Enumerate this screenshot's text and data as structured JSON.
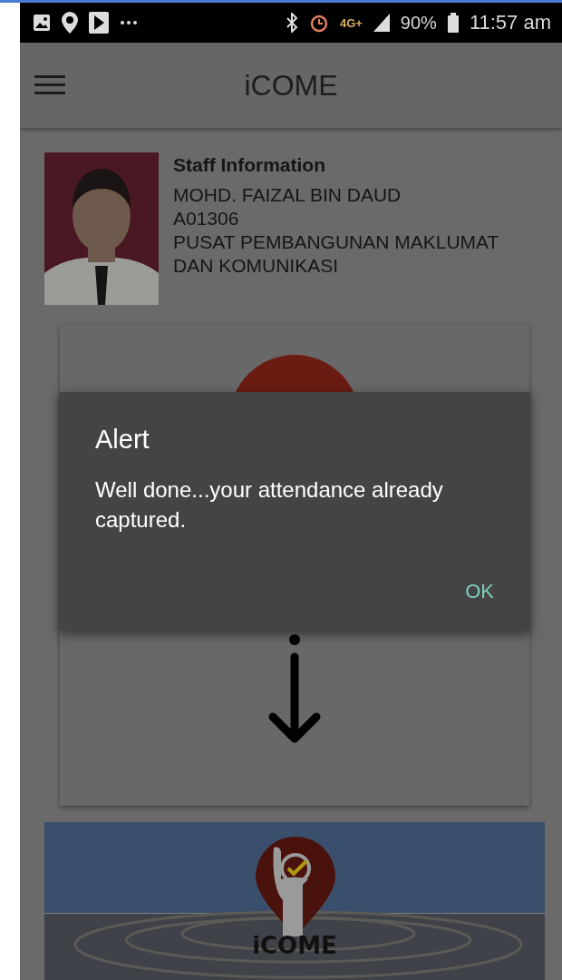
{
  "status_bar": {
    "network": "4G+",
    "battery": "90%",
    "time": "11:57 am"
  },
  "app_bar": {
    "title": "iCOME"
  },
  "staff": {
    "heading": "Staff Information",
    "name": "MOHD. FAIZAL BIN DAUD",
    "id": "A01306",
    "department": "PUSAT PEMBANGUNAN MAKLUMAT DAN KOMUNIKASI"
  },
  "banner": {
    "label": "iCOME"
  },
  "dialog": {
    "title": "Alert",
    "message": "Well done...your attendance already captured.",
    "buttons": [
      "OK"
    ]
  }
}
